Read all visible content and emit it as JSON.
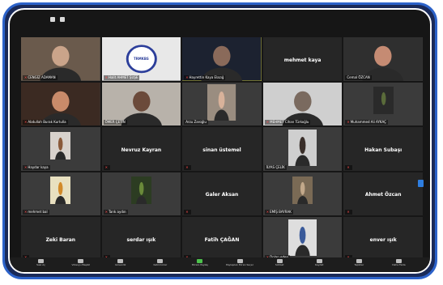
{
  "colors": {
    "frame": "#2c62c9",
    "tile_bg": "#262626",
    "active_outline": "#e9e23a",
    "muted_mic": "#ff4a4a",
    "toolbar_bg": "#1d1d1d"
  },
  "participants": [
    {
      "label": "CENGİZ ADAMAN",
      "name": "",
      "video": true,
      "muted": true
    },
    {
      "label": "Halit AHMET ŞUŞE",
      "name": "",
      "video": true,
      "muted": true,
      "logo": "TRMKBS"
    },
    {
      "label": "Hayrettin Kaya Elazığ",
      "name": "",
      "video": true,
      "muted": true,
      "active": true
    },
    {
      "label": "",
      "name": "mehmet kaya",
      "video": false,
      "muted": false
    },
    {
      "label": "Cemal ÖZCAN",
      "name": "",
      "video": true,
      "muted": false
    },
    {
      "label": "Abdullah Burak Kurtulla",
      "name": "",
      "video": true,
      "muted": true
    },
    {
      "label": "ÖMER ÇETİN",
      "name": "",
      "video": true,
      "muted": false
    },
    {
      "label": "Arzu Zaroğlu",
      "name": "",
      "video": true,
      "muted": false
    },
    {
      "label": "MEHMET Cihan Türkoğlu",
      "name": "",
      "video": true,
      "muted": true
    },
    {
      "label": "Muhammed Ali AYKAÇ",
      "name": "",
      "video": true,
      "muted": true
    },
    {
      "label": "Haydar kaya",
      "name": "",
      "video": true,
      "muted": true
    },
    {
      "label": "",
      "name": "Nevruz Kayran",
      "video": false,
      "muted": true
    },
    {
      "label": "",
      "name": "sinan üstemel",
      "video": false,
      "muted": true
    },
    {
      "label": "İLYAS ÇELİK",
      "name": "",
      "video": true,
      "muted": false
    },
    {
      "label": "",
      "name": "Hakan Subaşı",
      "video": false,
      "muted": true
    },
    {
      "label": "mehmet bal",
      "name": "",
      "video": true,
      "muted": true
    },
    {
      "label": "Tarık aydın",
      "name": "",
      "video": true,
      "muted": true
    },
    {
      "label": "",
      "name": "Galer Aksan",
      "video": false,
      "muted": true
    },
    {
      "label": "EMİŞ BAYRAK",
      "name": "",
      "video": true,
      "muted": true
    },
    {
      "label": "",
      "name": "Ahmet Özcan",
      "video": false,
      "muted": true
    },
    {
      "label": "",
      "name": "Zeki Baran",
      "video": false,
      "muted": true
    },
    {
      "label": "",
      "name": "serdar ışık",
      "video": false,
      "muted": true
    },
    {
      "label": "",
      "name": "Fatih ÇAĞAN",
      "video": false,
      "muted": true
    },
    {
      "label": "Dolan eden",
      "name": "",
      "video": true,
      "muted": true
    },
    {
      "label": "",
      "name": "enver ışık",
      "video": false,
      "muted": true
    }
  ],
  "toolbar": [
    {
      "label": "Sesi Aç",
      "icon": "mic-icon"
    },
    {
      "label": "Videoyu Başlat",
      "icon": "camera-icon"
    },
    {
      "label": "Güvenlik",
      "icon": "shield-icon"
    },
    {
      "label": "Katılımcılar",
      "icon": "people-icon"
    },
    {
      "label": "Ekranı Paylaş",
      "icon": "share-screen-icon",
      "accent": true
    },
    {
      "label": "Paylaşılan Ekran Seçenekleri",
      "icon": "options-icon"
    },
    {
      "label": "Sohbet",
      "icon": "chat-icon"
    },
    {
      "label": "Kaydet",
      "icon": "record-icon"
    },
    {
      "label": "Tepkiler",
      "icon": "reactions-icon"
    },
    {
      "label": "Daha Fazla",
      "icon": "more-icon"
    }
  ]
}
